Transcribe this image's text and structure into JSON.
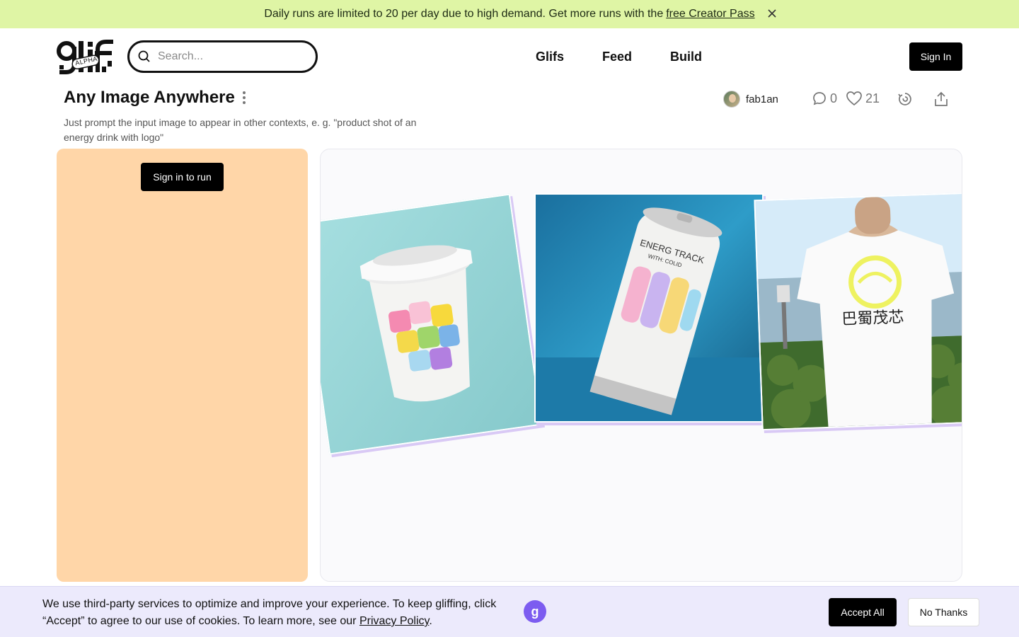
{
  "banner": {
    "text": "Daily runs are limited to 20 per day due to high demand. Get more runs with the",
    "link": "free Creator Pass",
    "close_icon": "close-icon"
  },
  "header": {
    "logo_text": "glif",
    "logo_badge": "ALPHA",
    "search_placeholder": "Search...",
    "nav": [
      "Glifs",
      "Feed",
      "Build"
    ],
    "signin_label": "Sign In"
  },
  "glif": {
    "title": "Any Image Anywhere",
    "description": "Just prompt the input image to appear in other contexts, e. g. \"product shot of an energy drink with logo\"",
    "author": "fab1an",
    "comments": "0",
    "likes": "21"
  },
  "left_panel": {
    "run_label": "Sign in to run",
    "bg_color": "#ffd6a8"
  },
  "preview": {
    "can_text_line1": "ENERG TRACK",
    "can_text_line2": "WITH: COLID",
    "shirt_text": "巴蜀茂芯"
  },
  "cookie": {
    "text": "We use third-party services to optimize and improve your experience. To keep gliffing, click “Accept” to agree to our use of cookies. To learn more, see our",
    "link": "Privacy Policy",
    "suffix": ".",
    "logo_letter": "g",
    "accept_label": "Accept All",
    "decline_label": "No Thanks"
  },
  "colors": {
    "banner": "#dff5a5",
    "accent": "#7c5cf0",
    "cookie_bg": "#eceafc"
  }
}
